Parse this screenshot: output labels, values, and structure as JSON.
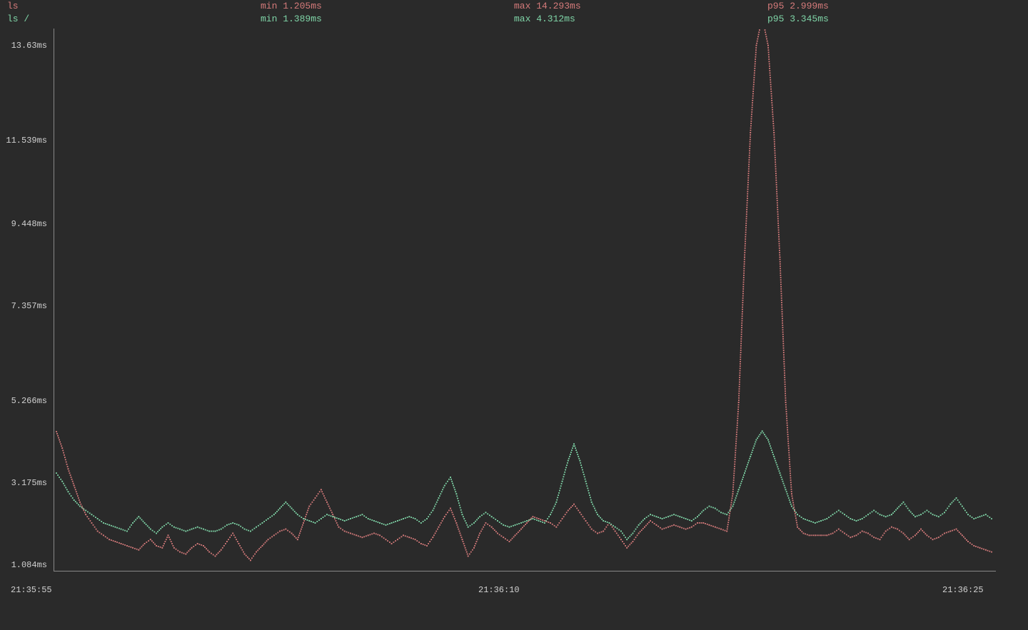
{
  "header": {
    "cols": [
      {
        "rows": [
          "ls",
          "ls /"
        ]
      },
      {
        "rows": [
          "min 1.205ms",
          "min 1.389ms"
        ]
      },
      {
        "rows": [
          "max 14.293ms",
          "max 4.312ms"
        ]
      },
      {
        "rows": [
          "p95 2.999ms",
          "p95 3.345ms"
        ]
      }
    ]
  },
  "y_ticks": [
    "13.63ms",
    "11.539ms",
    "9.448ms",
    "7.357ms",
    "5.266ms",
    "3.175ms",
    "1.084ms"
  ],
  "x_ticks": [
    "21:35:55",
    "21:36:10",
    "21:36:25"
  ],
  "colors": {
    "series_a": "#d47a7a",
    "series_b": "#7fd4a7",
    "axis": "#888888",
    "bg": "#2a2a2a"
  },
  "chart_data": {
    "type": "line",
    "xlabel": "",
    "ylabel": "",
    "ylim": [
      1.084,
      13.63
    ],
    "xlim": [
      "21:35:55",
      "21:36:25"
    ],
    "title": "",
    "x": [
      0,
      1,
      2,
      3,
      4,
      5,
      6,
      7,
      8,
      9,
      10,
      11,
      12,
      13,
      14,
      15,
      16,
      17,
      18,
      19,
      20,
      21,
      22,
      23,
      24,
      25,
      26,
      27,
      28,
      29,
      30,
      31,
      32,
      33,
      34,
      35,
      36,
      37,
      38,
      39,
      40,
      41,
      42,
      43,
      44,
      45,
      46,
      47,
      48,
      49,
      50,
      51,
      52,
      53,
      54,
      55,
      56,
      57,
      58,
      59,
      60,
      61,
      62,
      63,
      64,
      65,
      66,
      67,
      68,
      69,
      70,
      71,
      72,
      73,
      74,
      75,
      76,
      77,
      78,
      79,
      80,
      81,
      82,
      83,
      84,
      85,
      86,
      87,
      88,
      89,
      90,
      91,
      92,
      93,
      94,
      95,
      96,
      97,
      98,
      99,
      100,
      101,
      102,
      103,
      104,
      105,
      106,
      107,
      108,
      109,
      110,
      111,
      112,
      113,
      114,
      115,
      116,
      117,
      118,
      119,
      120,
      121,
      122,
      123,
      124,
      125,
      126,
      127,
      128,
      129,
      130,
      131,
      132,
      133,
      134,
      135,
      136,
      137,
      138,
      139,
      140,
      141,
      142,
      143,
      144,
      145,
      146,
      147,
      148,
      149,
      150,
      151,
      152,
      153,
      154,
      155,
      156,
      157,
      158,
      159
    ],
    "series": [
      {
        "name": "ls",
        "color": "#d47a7a",
        "values": [
          4.3,
          3.9,
          3.4,
          3.0,
          2.6,
          2.3,
          2.1,
          1.9,
          1.8,
          1.7,
          1.65,
          1.6,
          1.55,
          1.5,
          1.45,
          1.6,
          1.7,
          1.55,
          1.5,
          1.8,
          1.5,
          1.4,
          1.35,
          1.5,
          1.6,
          1.55,
          1.4,
          1.3,
          1.45,
          1.65,
          1.85,
          1.6,
          1.35,
          1.2,
          1.4,
          1.55,
          1.7,
          1.8,
          1.9,
          1.95,
          1.85,
          1.7,
          2.1,
          2.5,
          2.7,
          2.9,
          2.6,
          2.3,
          2.0,
          1.9,
          1.85,
          1.8,
          1.75,
          1.8,
          1.85,
          1.8,
          1.7,
          1.6,
          1.7,
          1.8,
          1.75,
          1.7,
          1.6,
          1.55,
          1.75,
          2.0,
          2.25,
          2.45,
          2.1,
          1.7,
          1.3,
          1.5,
          1.85,
          2.1,
          2.0,
          1.85,
          1.75,
          1.65,
          1.8,
          1.95,
          2.1,
          2.25,
          2.2,
          2.15,
          2.1,
          2.0,
          2.2,
          2.4,
          2.55,
          2.35,
          2.15,
          1.95,
          1.85,
          1.9,
          2.1,
          1.9,
          1.7,
          1.5,
          1.65,
          1.85,
          2.0,
          2.15,
          2.05,
          1.95,
          2.0,
          2.05,
          2.0,
          1.95,
          2.0,
          2.1,
          2.1,
          2.05,
          2.0,
          1.95,
          1.9,
          2.8,
          5.0,
          8.5,
          11.5,
          13.6,
          14.29,
          13.6,
          11.5,
          8.5,
          5.0,
          2.8,
          2.0,
          1.85,
          1.8,
          1.8,
          1.8,
          1.8,
          1.85,
          1.95,
          1.85,
          1.75,
          1.8,
          1.9,
          1.85,
          1.75,
          1.7,
          1.9,
          2.0,
          1.95,
          1.85,
          1.7,
          1.8,
          1.95,
          1.8,
          1.7,
          1.75,
          1.85,
          1.9,
          1.95,
          1.8,
          1.65,
          1.55,
          1.5,
          1.45,
          1.4
        ]
      },
      {
        "name": "ls /",
        "color": "#7fd4a7",
        "values": [
          3.3,
          3.1,
          2.85,
          2.65,
          2.5,
          2.4,
          2.3,
          2.2,
          2.1,
          2.05,
          2.0,
          1.95,
          1.9,
          2.1,
          2.25,
          2.1,
          1.95,
          1.85,
          2.0,
          2.1,
          2.0,
          1.95,
          1.9,
          1.95,
          2.0,
          1.95,
          1.9,
          1.9,
          1.95,
          2.05,
          2.1,
          2.05,
          1.95,
          1.9,
          2.0,
          2.1,
          2.2,
          2.3,
          2.45,
          2.6,
          2.45,
          2.3,
          2.2,
          2.15,
          2.1,
          2.2,
          2.3,
          2.25,
          2.2,
          2.15,
          2.2,
          2.25,
          2.3,
          2.2,
          2.15,
          2.1,
          2.05,
          2.1,
          2.15,
          2.2,
          2.25,
          2.2,
          2.1,
          2.2,
          2.4,
          2.7,
          3.0,
          3.2,
          2.8,
          2.3,
          2.0,
          2.1,
          2.25,
          2.35,
          2.25,
          2.15,
          2.05,
          2.0,
          2.05,
          2.1,
          2.15,
          2.2,
          2.15,
          2.1,
          2.3,
          2.6,
          3.1,
          3.6,
          4.0,
          3.6,
          3.1,
          2.6,
          2.3,
          2.15,
          2.1,
          2.0,
          1.9,
          1.7,
          1.85,
          2.05,
          2.2,
          2.3,
          2.25,
          2.2,
          2.25,
          2.3,
          2.25,
          2.2,
          2.15,
          2.25,
          2.4,
          2.5,
          2.45,
          2.35,
          2.3,
          2.5,
          2.9,
          3.3,
          3.7,
          4.1,
          4.31,
          4.1,
          3.7,
          3.3,
          2.9,
          2.5,
          2.3,
          2.2,
          2.15,
          2.1,
          2.15,
          2.2,
          2.3,
          2.4,
          2.3,
          2.2,
          2.15,
          2.2,
          2.3,
          2.4,
          2.3,
          2.25,
          2.3,
          2.45,
          2.6,
          2.4,
          2.25,
          2.3,
          2.4,
          2.3,
          2.25,
          2.35,
          2.55,
          2.7,
          2.5,
          2.3,
          2.2,
          2.25,
          2.3,
          2.2
        ]
      }
    ]
  }
}
